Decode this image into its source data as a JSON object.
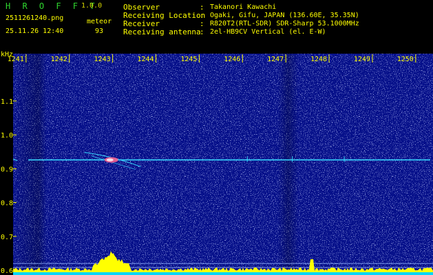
{
  "app": {
    "name": "H R O F F T",
    "version": "1.0.0",
    "filename": "2511261240.png",
    "datetime": "25.11.26 12:40",
    "meteor_label": "meteor",
    "meteor_count": "93"
  },
  "info": [
    {
      "key": "Observer",
      "value": "Takanori Kawachi"
    },
    {
      "key": "Receiving Location",
      "value": "Ogaki, Gifu, JAPAN (136.60E, 35.35N)"
    },
    {
      "key": "Receiver",
      "value": "R820T2(RTL-SDR) SDR-Sharp 53.1000MHz"
    },
    {
      "key": "Receiving antenna",
      "value": "2el-HB9CV Vertical (el. E-W)"
    }
  ],
  "separator": ":",
  "axis": {
    "y_unit": "kHz",
    "time_labels": [
      "1241",
      "1242",
      "1243",
      "1244",
      "1245",
      "1246",
      "1247",
      "1248",
      "1249",
      "1250"
    ],
    "time_range": [
      1240.7,
      1250.4
    ],
    "freq_labels": [
      "1.1",
      "1.0",
      "0.9",
      "0.8",
      "0.7",
      "0.6"
    ],
    "freq_range": [
      0.586,
      1.24
    ]
  },
  "colors": {
    "background": "#000000",
    "spectrum": "#06108a",
    "header_text": "#ffff00",
    "title_text": "#2fd62f",
    "carrier": "#39d7ff",
    "echo": "#ff5a8a",
    "ref_line": "#8fb0ff",
    "level_fill": "#ffff00",
    "level_base": "#00d5ff"
  },
  "carrier_freq": 0.926,
  "reference_lines": [
    0.62,
    0.608
  ],
  "meteor_echo": {
    "start_time": 1242.35,
    "end_time": 1243.65,
    "freq_start": 0.944,
    "freq_end": 0.906,
    "peak_time": 1242.97
  }
}
